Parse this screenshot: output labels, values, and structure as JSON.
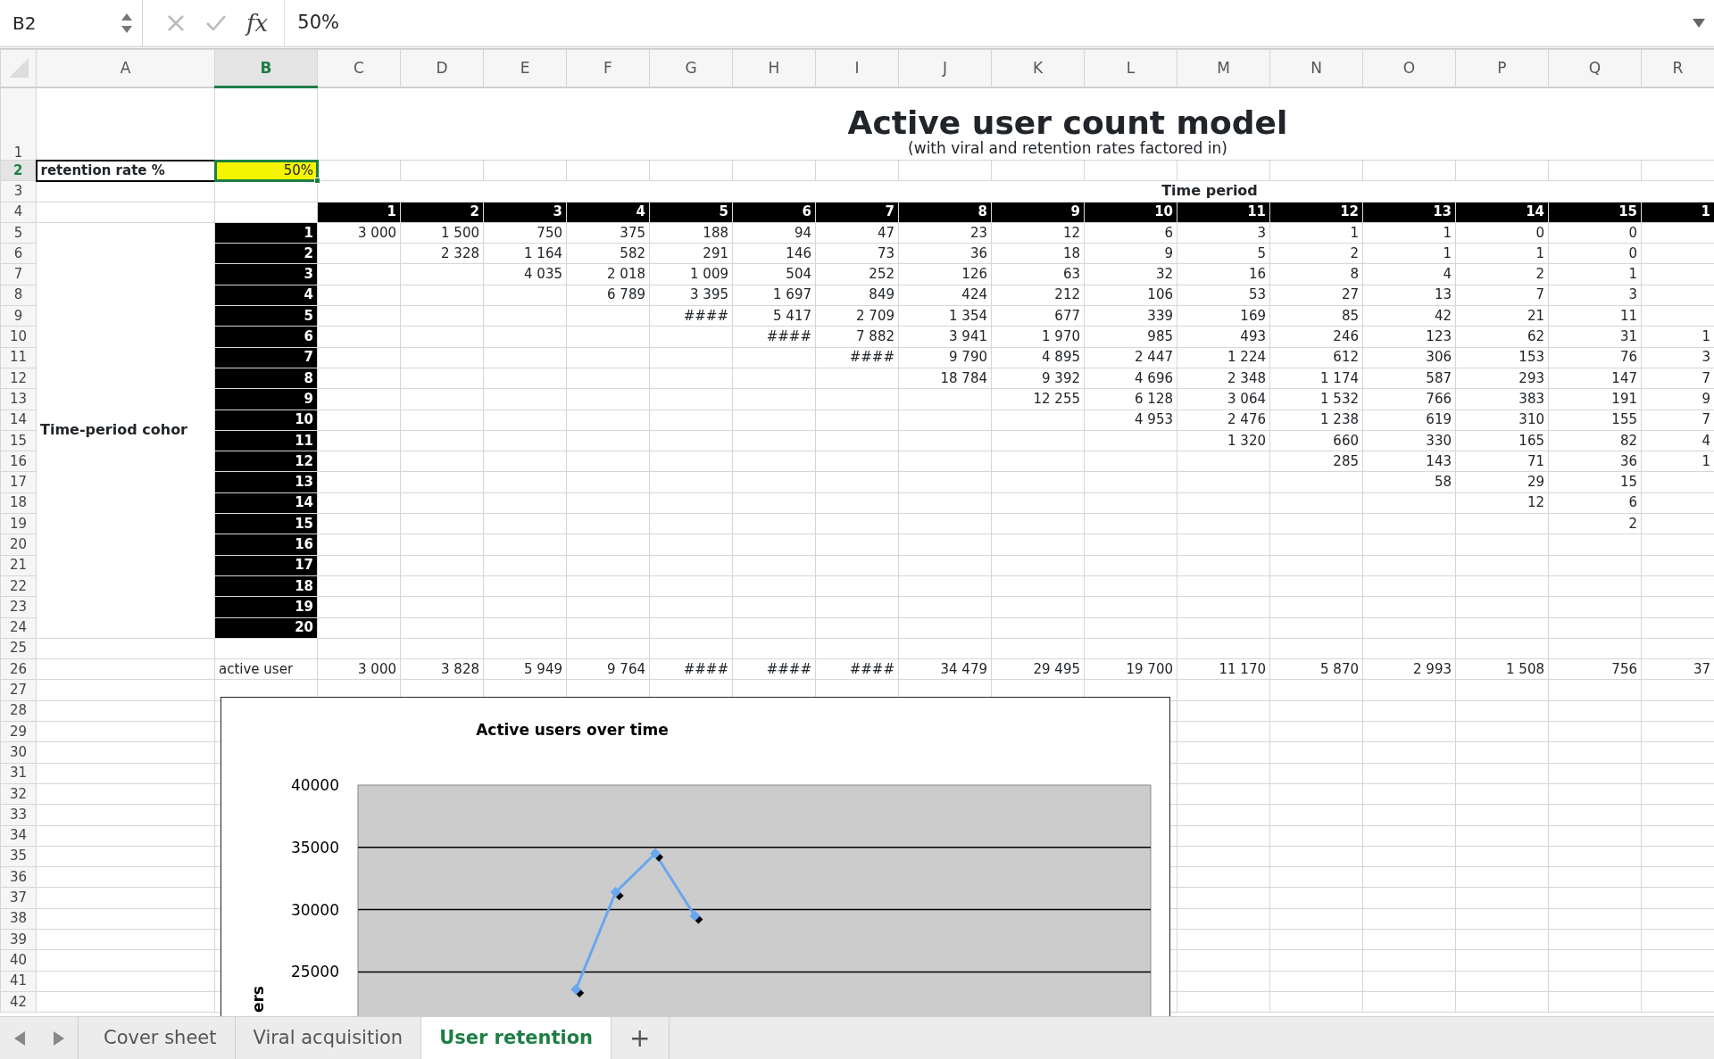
{
  "formula_bar": {
    "cell_ref": "B2",
    "fx_label": "fx",
    "value": "50%"
  },
  "columns": [
    {
      "label": "A",
      "selected": false
    },
    {
      "label": "B",
      "selected": true
    },
    {
      "label": "C",
      "selected": false
    },
    {
      "label": "D",
      "selected": false
    },
    {
      "label": "E",
      "selected": false
    },
    {
      "label": "F",
      "selected": false
    },
    {
      "label": "G",
      "selected": false
    },
    {
      "label": "H",
      "selected": false
    },
    {
      "label": "I",
      "selected": false
    },
    {
      "label": "J",
      "selected": false
    },
    {
      "label": "K",
      "selected": false
    },
    {
      "label": "L",
      "selected": false
    },
    {
      "label": "M",
      "selected": false
    },
    {
      "label": "N",
      "selected": false
    },
    {
      "label": "O",
      "selected": false
    },
    {
      "label": "P",
      "selected": false
    },
    {
      "label": "Q",
      "selected": false
    },
    {
      "label": "R",
      "selected": false
    }
  ],
  "rows": [
    {
      "label": "1",
      "selected": false
    },
    {
      "label": "2",
      "selected": true
    },
    {
      "label": "3",
      "selected": false
    },
    {
      "label": "4",
      "selected": false
    },
    {
      "label": "5",
      "selected": false
    },
    {
      "label": "6",
      "selected": false
    },
    {
      "label": "7",
      "selected": false
    },
    {
      "label": "8",
      "selected": false
    },
    {
      "label": "9",
      "selected": false
    },
    {
      "label": "10",
      "selected": false
    },
    {
      "label": "11",
      "selected": false
    },
    {
      "label": "12",
      "selected": false
    },
    {
      "label": "13",
      "selected": false
    },
    {
      "label": "14",
      "selected": false
    },
    {
      "label": "15",
      "selected": false
    },
    {
      "label": "16",
      "selected": false
    },
    {
      "label": "17",
      "selected": false
    },
    {
      "label": "18",
      "selected": false
    },
    {
      "label": "19",
      "selected": false
    },
    {
      "label": "20",
      "selected": false
    },
    {
      "label": "21",
      "selected": false
    },
    {
      "label": "22",
      "selected": false
    },
    {
      "label": "23",
      "selected": false
    },
    {
      "label": "24",
      "selected": false
    },
    {
      "label": "25",
      "selected": false
    },
    {
      "label": "26",
      "selected": false
    },
    {
      "label": "27",
      "selected": false
    },
    {
      "label": "28",
      "selected": false
    },
    {
      "label": "29",
      "selected": false
    },
    {
      "label": "30",
      "selected": false
    },
    {
      "label": "31",
      "selected": false
    },
    {
      "label": "32",
      "selected": false
    },
    {
      "label": "33",
      "selected": false
    },
    {
      "label": "34",
      "selected": false
    },
    {
      "label": "35",
      "selected": false
    },
    {
      "label": "36",
      "selected": false
    },
    {
      "label": "37",
      "selected": false
    },
    {
      "label": "38",
      "selected": false
    },
    {
      "label": "39",
      "selected": false
    },
    {
      "label": "40",
      "selected": false
    },
    {
      "label": "41",
      "selected": false
    },
    {
      "label": "42",
      "selected": false
    }
  ],
  "title": "Active user count model",
  "subtitle": "(with viral and retention rates factored in)",
  "retention": {
    "label": "retention rate %",
    "value": "50%",
    "selected": true
  },
  "time_period_label": "Time period",
  "period_headers": [
    "1",
    "2",
    "3",
    "4",
    "5",
    "6",
    "7",
    "8",
    "9",
    "10",
    "11",
    "12",
    "13",
    "14",
    "15",
    "1"
  ],
  "cohort_label": "Time-period cohor",
  "cohorts": [
    {
      "label": "1",
      "values": [
        "3 000",
        "1 500",
        "750",
        "375",
        "188",
        "94",
        "47",
        "23",
        "12",
        "6",
        "3",
        "1",
        "1",
        "0",
        "0"
      ]
    },
    {
      "label": "2",
      "values": [
        "2 328",
        "1 164",
        "582",
        "291",
        "146",
        "73",
        "36",
        "18",
        "9",
        "5",
        "2",
        "1",
        "1",
        "0"
      ]
    },
    {
      "label": "3",
      "values": [
        "4 035",
        "2 018",
        "1 009",
        "504",
        "252",
        "126",
        "63",
        "32",
        "16",
        "8",
        "4",
        "2",
        "1"
      ]
    },
    {
      "label": "4",
      "values": [
        "6 789",
        "3 395",
        "1 697",
        "849",
        "424",
        "212",
        "106",
        "53",
        "27",
        "13",
        "7",
        "3"
      ]
    },
    {
      "label": "5",
      "values": [
        "####",
        "5 417",
        "2 709",
        "1 354",
        "677",
        "339",
        "169",
        "85",
        "42",
        "21",
        "11"
      ]
    },
    {
      "label": "6",
      "values": [
        "####",
        "7 882",
        "3 941",
        "1 970",
        "985",
        "493",
        "246",
        "123",
        "62",
        "31",
        "1"
      ]
    },
    {
      "label": "7",
      "values": [
        "####",
        "9 790",
        "4 895",
        "2 447",
        "1 224",
        "612",
        "306",
        "153",
        "76",
        "3"
      ]
    },
    {
      "label": "8",
      "values": [
        "18 784",
        "9 392",
        "4 696",
        "2 348",
        "1 174",
        "587",
        "293",
        "147",
        "7"
      ]
    },
    {
      "label": "9",
      "values": [
        "12 255",
        "6 128",
        "3 064",
        "1 532",
        "766",
        "383",
        "191",
        "9"
      ]
    },
    {
      "label": "10",
      "values": [
        "4 953",
        "2 476",
        "1 238",
        "619",
        "310",
        "155",
        "7"
      ]
    },
    {
      "label": "11",
      "values": [
        "1 320",
        "660",
        "330",
        "165",
        "82",
        "4"
      ]
    },
    {
      "label": "12",
      "values": [
        "285",
        "143",
        "71",
        "36",
        "1"
      ]
    },
    {
      "label": "13",
      "values": [
        "58",
        "29",
        "15"
      ]
    },
    {
      "label": "14",
      "values": [
        "12",
        "6"
      ]
    },
    {
      "label": "15",
      "values": [
        "2"
      ]
    },
    {
      "label": "16"
    },
    {
      "label": "17"
    },
    {
      "label": "18"
    },
    {
      "label": "19"
    },
    {
      "label": "20"
    }
  ],
  "total_label": "active user",
  "totals": [
    "3 000",
    "3 828",
    "5 949",
    "9 764",
    "####",
    "####",
    "####",
    "34 479",
    "29 495",
    "19 700",
    "11 170",
    "5 870",
    "2 993",
    "1 508",
    "756",
    "37"
  ],
  "chart": {
    "chart_data": {
      "type": "line",
      "title": "Active users over time",
      "ylabel": "ers",
      "ylim": [
        0,
        40000
      ],
      "yticks": [
        25000,
        30000,
        35000,
        40000
      ],
      "grid": true,
      "series": [
        {
          "color": "#6aa6f0",
          "marker": "diamond",
          "values": [
            null,
            null,
            null,
            null,
            null,
            23600,
            31400,
            34500,
            29500,
            null,
            null,
            null,
            null,
            null,
            null,
            null,
            null,
            null,
            null,
            null
          ]
        }
      ]
    }
  },
  "sheet_tabs": [
    {
      "label": "Cover sheet",
      "selected": false
    },
    {
      "label": "Viral acquisition",
      "selected": false
    },
    {
      "label": "User retention",
      "selected": true
    }
  ],
  "add_sheet": "+"
}
